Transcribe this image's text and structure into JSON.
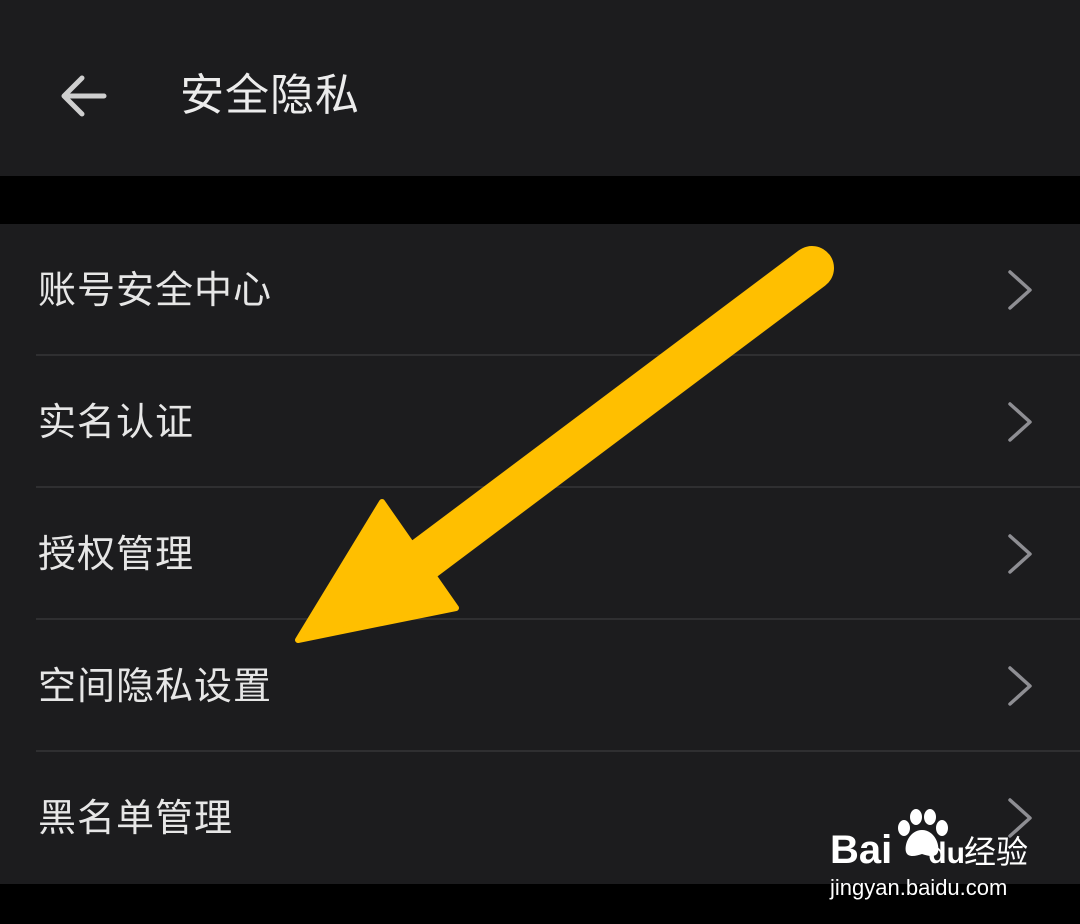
{
  "header": {
    "title": "安全隐私",
    "back_icon": "arrow-left-icon"
  },
  "settings": {
    "items": [
      {
        "label": "账号安全中心",
        "icon": "chevron-right-icon"
      },
      {
        "label": "实名认证",
        "icon": "chevron-right-icon"
      },
      {
        "label": "授权管理",
        "icon": "chevron-right-icon"
      },
      {
        "label": "空间隐私设置",
        "icon": "chevron-right-icon"
      },
      {
        "label": "黑名单管理",
        "icon": "chevron-right-icon"
      }
    ]
  },
  "annotation": {
    "arrow_color": "#ffbf00",
    "points_to": "空间隐私设置"
  },
  "watermark": {
    "logo": "Bai",
    "logo_suffix": "du",
    "product": "经验",
    "url": "jingyan.baidu.com"
  },
  "colors": {
    "background": "#000000",
    "surface": "#1c1c1e",
    "text": "#e6e6e6",
    "divider": "#2f2f31",
    "icon": "#8e8e93"
  }
}
